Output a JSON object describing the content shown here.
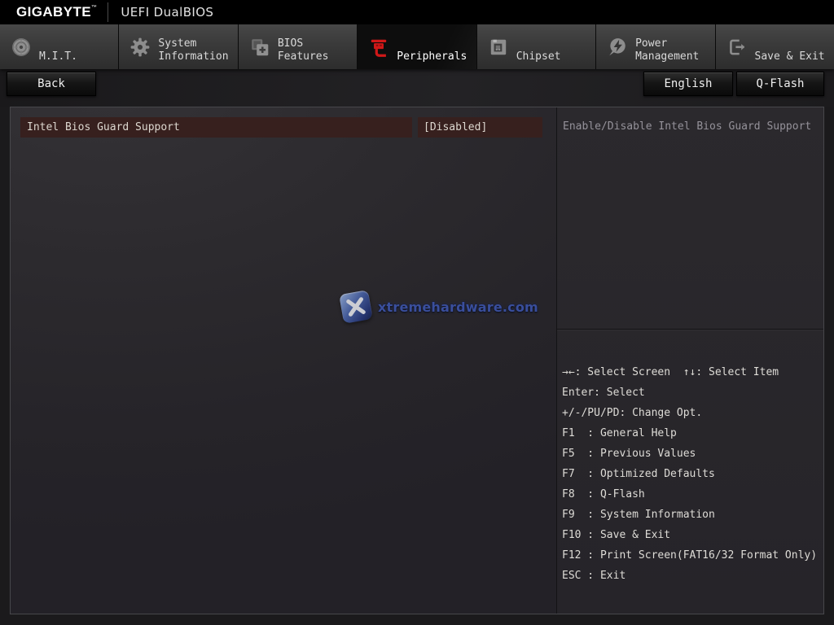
{
  "header": {
    "brand": "GIGABYTE",
    "brand_tm": "™",
    "title": "UEFI DualBIOS"
  },
  "tabs": [
    {
      "id": "mit",
      "lines": [
        "",
        "M.I.T."
      ],
      "icon": "dial-icon",
      "active": false
    },
    {
      "id": "system-information",
      "lines": [
        "System",
        "Information"
      ],
      "icon": "gear-icon",
      "active": false
    },
    {
      "id": "bios-features",
      "lines": [
        "BIOS",
        "Features"
      ],
      "icon": "chips-icon",
      "active": false
    },
    {
      "id": "peripherals",
      "lines": [
        "",
        "Peripherals"
      ],
      "icon": "usb-device-icon",
      "active": true
    },
    {
      "id": "chipset",
      "lines": [
        "",
        "Chipset"
      ],
      "icon": "chip-icon",
      "active": false
    },
    {
      "id": "power-management",
      "lines": [
        "Power",
        "Management"
      ],
      "icon": "lightning-icon",
      "active": false
    },
    {
      "id": "save-exit",
      "lines": [
        "",
        "Save & Exit"
      ],
      "icon": "exit-icon",
      "active": false
    }
  ],
  "toolbar": {
    "back_label": "Back",
    "language_label": "English",
    "qflash_label": "Q-Flash"
  },
  "settings": [
    {
      "name": "Intel Bios Guard Support",
      "value": "[Disabled]",
      "selected": true
    }
  ],
  "help_panel": {
    "text": "Enable/Disable Intel Bios Guard Support"
  },
  "shortcuts": [
    "→←: Select Screen  ↑↓: Select Item",
    "Enter: Select",
    "+/-/PU/PD: Change Opt.",
    "F1  : General Help",
    "F5  : Previous Values",
    "F7  : Optimized Defaults",
    "F8  : Q-Flash",
    "F9  : System Information",
    "F10 : Save & Exit",
    "F12 : Print Screen(FAT16/32 Format Only)",
    "ESC : Exit"
  ],
  "watermark": {
    "text": "xtremehardware.com"
  },
  "colors": {
    "accent_red": "#d01818",
    "selected_row_bg": "#37201e",
    "panel_bg": "#2a282c",
    "help_text": "#95929a",
    "tab_inactive_top": "#474747",
    "tab_active_bg": "#0d0d0d"
  }
}
